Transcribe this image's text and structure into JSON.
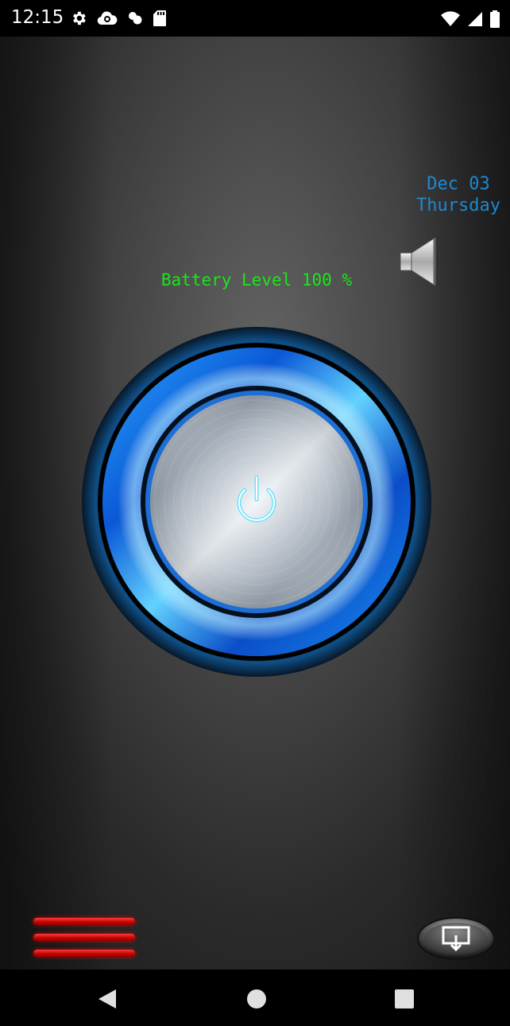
{
  "status_bar": {
    "time": "12:15",
    "left_icons": [
      "gear-icon",
      "cloud-icon",
      "puzzle-icon",
      "sd-card-icon"
    ],
    "right_icons": [
      "wifi-icon",
      "cell-signal-icon",
      "battery-icon"
    ]
  },
  "date": {
    "month_day": "Dec 03",
    "weekday": "Thursday",
    "color": "#1e88d0"
  },
  "battery": {
    "text": "Battery Level 100 %",
    "color": "#19e619"
  },
  "controls": {
    "speaker_icon": "speaker-icon",
    "power_icon": "power-icon",
    "menu_icon": "hamburger-menu-icon",
    "cast_icon": "screen-cast-icon"
  },
  "nav_bar": {
    "buttons": [
      "back-icon",
      "home-icon",
      "recents-icon"
    ]
  }
}
